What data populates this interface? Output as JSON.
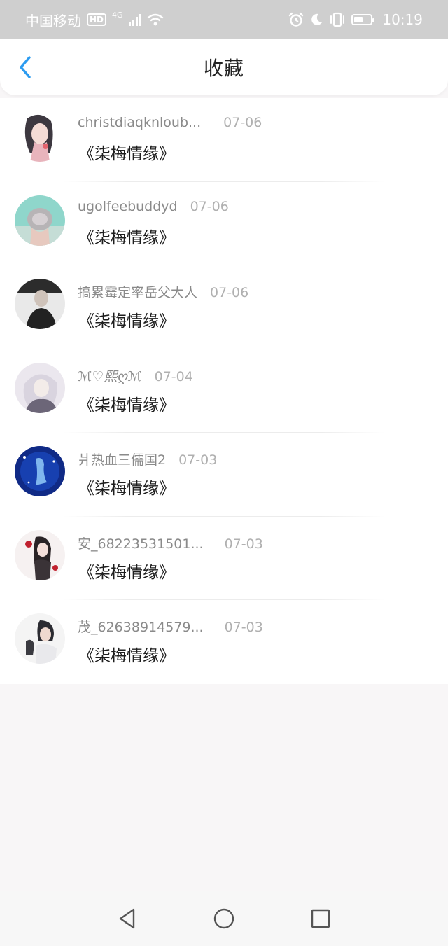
{
  "status_bar": {
    "carrier": "中国移动",
    "hd": "HD",
    "network": "4G",
    "time": "10:19"
  },
  "header": {
    "title": "收藏",
    "back_icon": "chevron-left-icon",
    "accent": "#2b9bf0"
  },
  "favorites": [
    {
      "name": "christdiaqknloub...",
      "date": "07-06",
      "title": "《柒梅情缘》",
      "avatar_colors": [
        "#f3dfe0",
        "#6d5a63"
      ]
    },
    {
      "name": "ugolfeebuddyd",
      "date": "07-06",
      "title": "《柒梅情缘》",
      "avatar_colors": [
        "#7fd3c8",
        "#c9ddd8"
      ]
    },
    {
      "name": "搞累霉定率岳父大人",
      "date": "07-06",
      "title": "《柒梅情缘》",
      "avatar_colors": [
        "#e6e6e6",
        "#2a2a2a"
      ]
    },
    {
      "name": "ℳ♡熙ღℳ",
      "date": "07-04",
      "title": "《柒梅情缘》",
      "avatar_colors": [
        "#dcd6e4",
        "#8d8799"
      ]
    },
    {
      "name": "爿热血三儒国2",
      "date": "07-03",
      "title": "《柒梅情缘》",
      "avatar_colors": [
        "#0d2a8a",
        "#5aa4e6"
      ]
    },
    {
      "name": "安_68223531501...",
      "date": "07-03",
      "title": "《柒梅情缘》",
      "avatar_colors": [
        "#f4eeee",
        "#b31b2b"
      ]
    },
    {
      "name": "茂_62638914579...",
      "date": "07-03",
      "title": "《柒梅情缘》",
      "avatar_colors": [
        "#f2f2f2",
        "#2d2d33"
      ]
    }
  ],
  "nav_bar": {
    "back_icon": "triangle-back-icon",
    "home_icon": "circle-home-icon",
    "recents_icon": "square-recents-icon"
  }
}
